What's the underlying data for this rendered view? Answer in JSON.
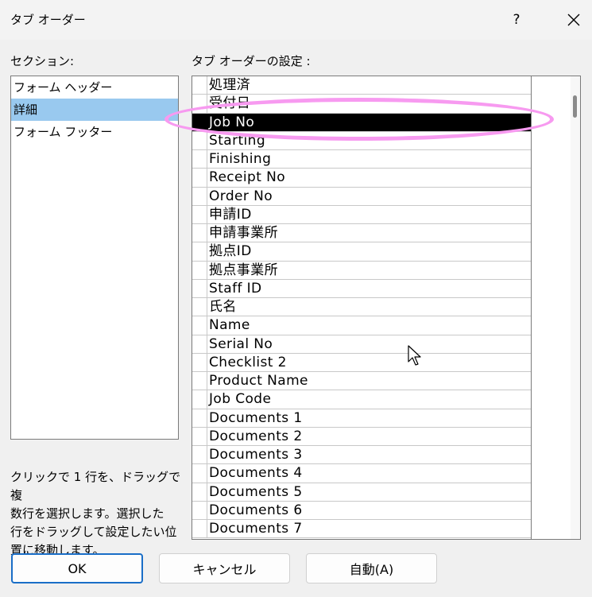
{
  "window": {
    "title": "タブ オーダー",
    "help_label": "?"
  },
  "section": {
    "label": "セクション:",
    "items": [
      "フォーム ヘッダー",
      "詳細",
      "フォーム フッター"
    ],
    "selected": "詳細"
  },
  "tab_order": {
    "label": "タブ オーダーの設定 :",
    "rows": [
      "処理済",
      "受付日",
      "Job No",
      "Starting",
      "Finishing",
      "Receipt No",
      "Order No",
      "申請ID",
      "申請事業所",
      "拠点ID",
      "拠点事業所",
      "Staff ID",
      "氏名",
      "Name",
      "Serial No",
      "Checklist 2",
      "Product Name",
      "Job Code",
      "Documents 1",
      "Documents 2",
      "Documents 3",
      "Documents 4",
      "Documents 5",
      "Documents 6",
      "Documents 7"
    ],
    "selected_row": "Job No"
  },
  "help_text": {
    "line1": "クリックで 1 行を、ドラッグで複",
    "line2": "数行を選択します。選択した",
    "line3": "行をドラッグして設定したい位",
    "line4": "置に移動します。"
  },
  "buttons": {
    "ok": "OK",
    "cancel": "キャンセル",
    "auto": "自動(A)"
  },
  "colors": {
    "selected_section": "#99c9ef",
    "selected_row": "#000000",
    "annotation": "#f79af0",
    "default_button_border": "#1a6ec7"
  }
}
